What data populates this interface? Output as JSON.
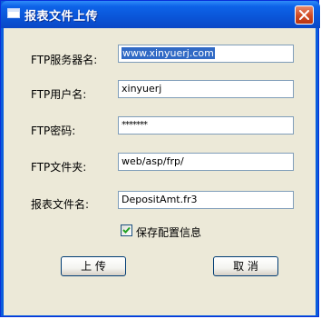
{
  "window": {
    "title": "报表文件上传"
  },
  "form": {
    "server_label": "FTP服务器名:",
    "server_value": "www.xinyuerj.com",
    "user_label": "FTP用户名:",
    "user_value": "xinyuerj",
    "password_label": "FTP密码:",
    "password_value": "*******",
    "folder_label": "FTP文件夹:",
    "folder_value": "web/asp/frp/",
    "filename_label": "报表文件名:",
    "filename_value": "DepositAmt.fr3",
    "save_config_label": "保存配置信息",
    "save_config_checked": true
  },
  "buttons": {
    "upload_label": "上 传",
    "cancel_label": "取 消"
  },
  "colors": {
    "titlebar": "#0a55d8",
    "dialog_bg": "#ece9d8",
    "selection": "#316ac5",
    "close_button": "#d04a22"
  },
  "icons": [
    "window-icon",
    "close-icon",
    "checkmark-icon"
  ]
}
